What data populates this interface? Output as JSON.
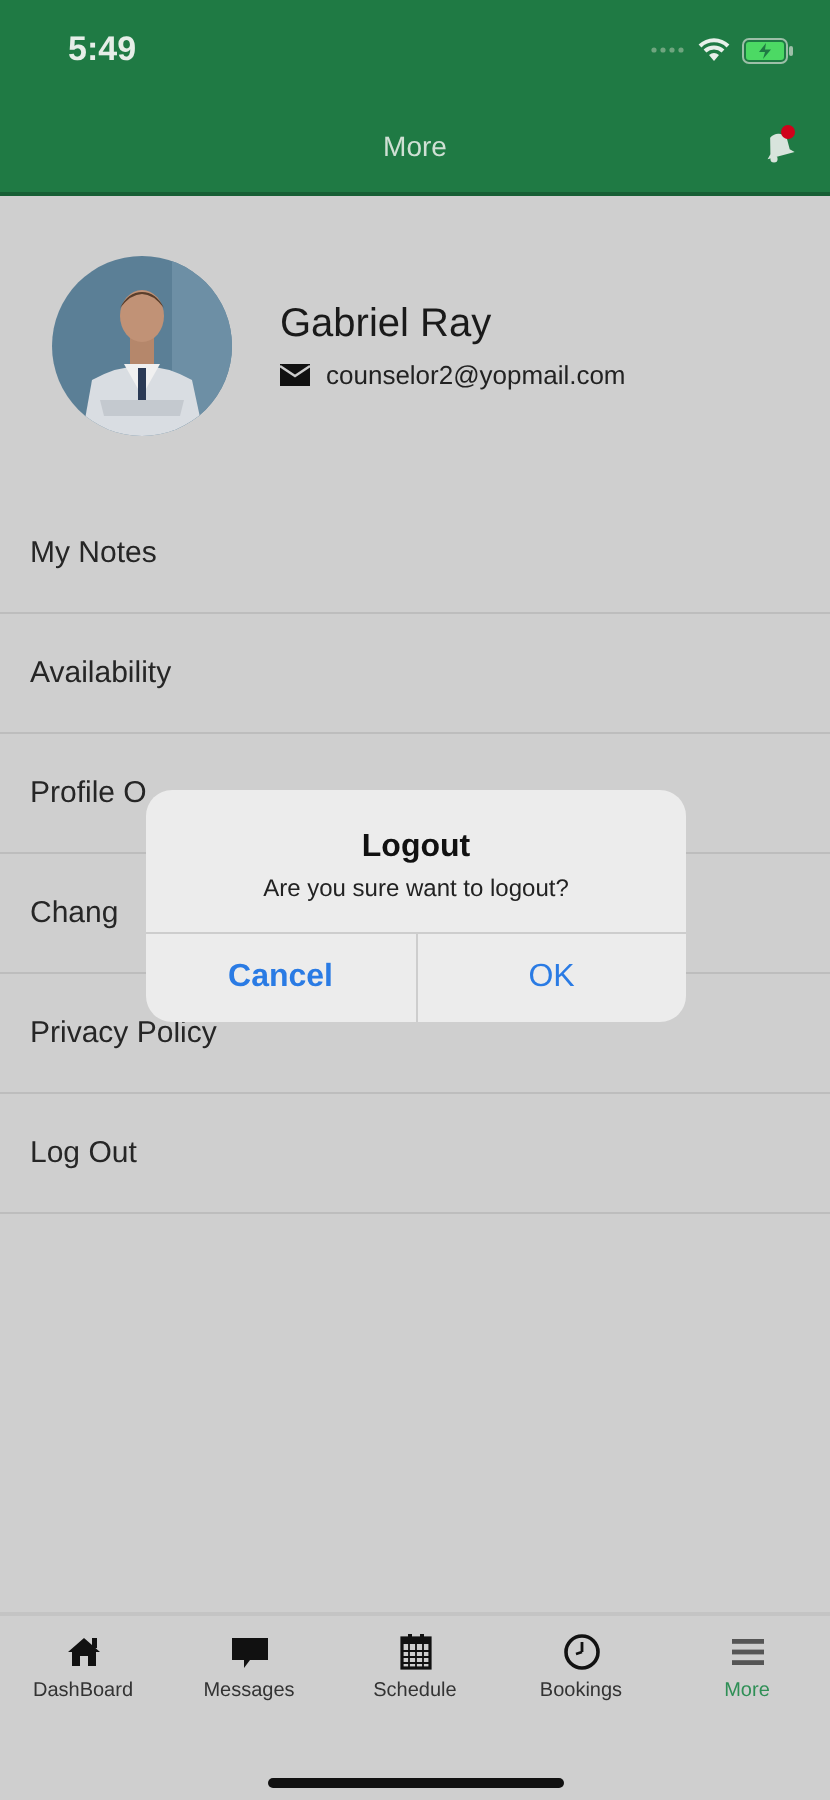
{
  "status_bar": {
    "time": "5:49"
  },
  "header": {
    "title": "More",
    "notification_dot": true
  },
  "profile": {
    "name": "Gabriel Ray",
    "email": "counselor2@yopmail.com"
  },
  "menu": [
    {
      "label": "My Notes"
    },
    {
      "label": "Availability"
    },
    {
      "label": "Profile O"
    },
    {
      "label": "Chang"
    },
    {
      "label": "Privacy Policy"
    },
    {
      "label": "Log Out"
    }
  ],
  "dialog": {
    "title": "Logout",
    "message": "Are you sure want to logout?",
    "buttons": [
      "Cancel",
      "OK"
    ]
  },
  "tabs": [
    {
      "label": "DashBoard",
      "kind": "home",
      "selected": false
    },
    {
      "label": "Messages",
      "kind": "chat",
      "selected": false
    },
    {
      "label": "Schedule",
      "kind": "calendar",
      "selected": false
    },
    {
      "label": "Bookings",
      "kind": "clock",
      "selected": false
    },
    {
      "label": "More",
      "kind": "menu",
      "selected": true
    }
  ]
}
